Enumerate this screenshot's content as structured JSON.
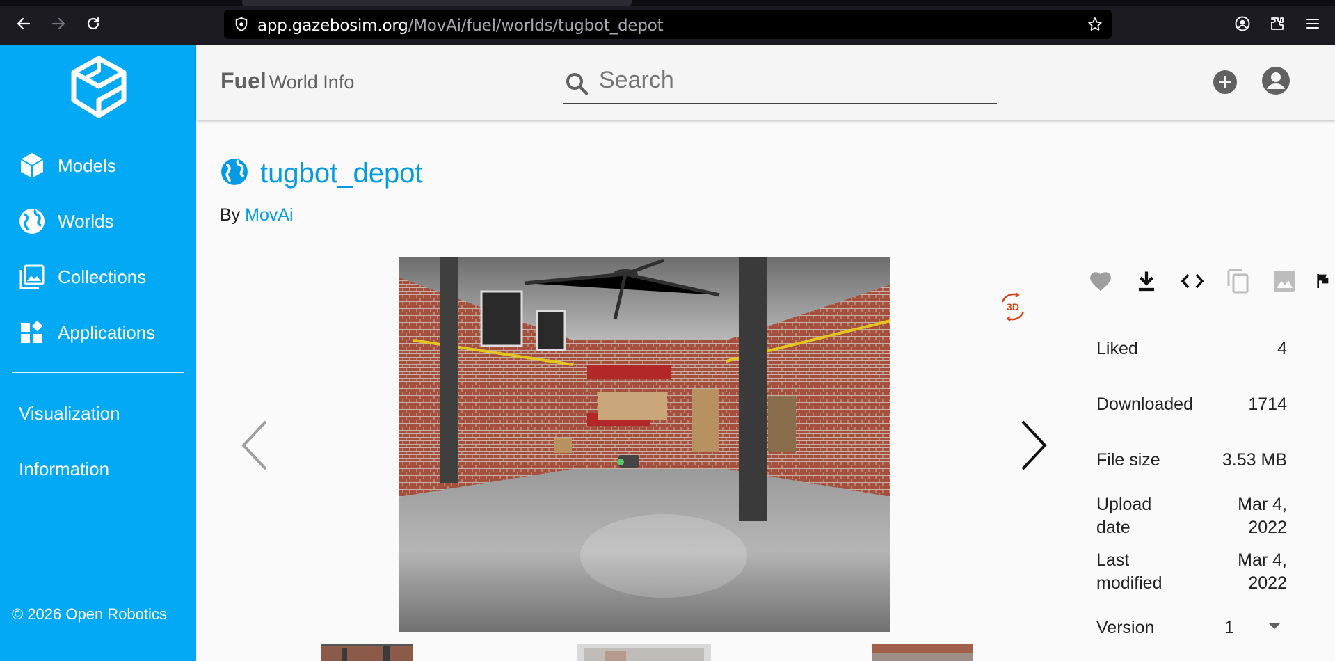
{
  "browser": {
    "url_domain": "app.gazebosim.org",
    "url_path": "/MovAi/fuel/worlds/tugbot_depot"
  },
  "sidebar": {
    "items": [
      {
        "label": "Models",
        "icon": "cube-icon"
      },
      {
        "label": "Worlds",
        "icon": "globe-icon"
      },
      {
        "label": "Collections",
        "icon": "collections-icon"
      },
      {
        "label": "Applications",
        "icon": "apps-icon"
      }
    ],
    "links": [
      {
        "label": "Visualization"
      },
      {
        "label": "Information"
      }
    ],
    "footer": "© 2026 Open Robotics"
  },
  "header": {
    "brand": "Fuel",
    "subtitle": "World Info",
    "search_placeholder": "Search"
  },
  "world": {
    "name": "tugbot_depot",
    "by_label": "By",
    "owner": "MovAi"
  },
  "viewer": {
    "badge_3d": "3D"
  },
  "actions": [
    "like-icon",
    "download-icon",
    "code-icon",
    "copy-icon",
    "image-icon",
    "flag-icon"
  ],
  "info": {
    "liked_label": "Liked",
    "liked_value": "4",
    "downloaded_label": "Downloaded",
    "downloaded_value": "1714",
    "filesize_label": "File size",
    "filesize_value": "3.53 MB",
    "upload_label_1": "Upload",
    "upload_label_2": "date",
    "upload_value_1": "Mar 4,",
    "upload_value_2": "2022",
    "modified_label_1": "Last",
    "modified_label_2": "modified",
    "modified_value_1": "Mar 4,",
    "modified_value_2": "2022",
    "version_label": "Version",
    "version_value": "1"
  },
  "colors": {
    "primary": "#03a9f4",
    "link": "#039be5",
    "threed_badge": "#d84315"
  }
}
